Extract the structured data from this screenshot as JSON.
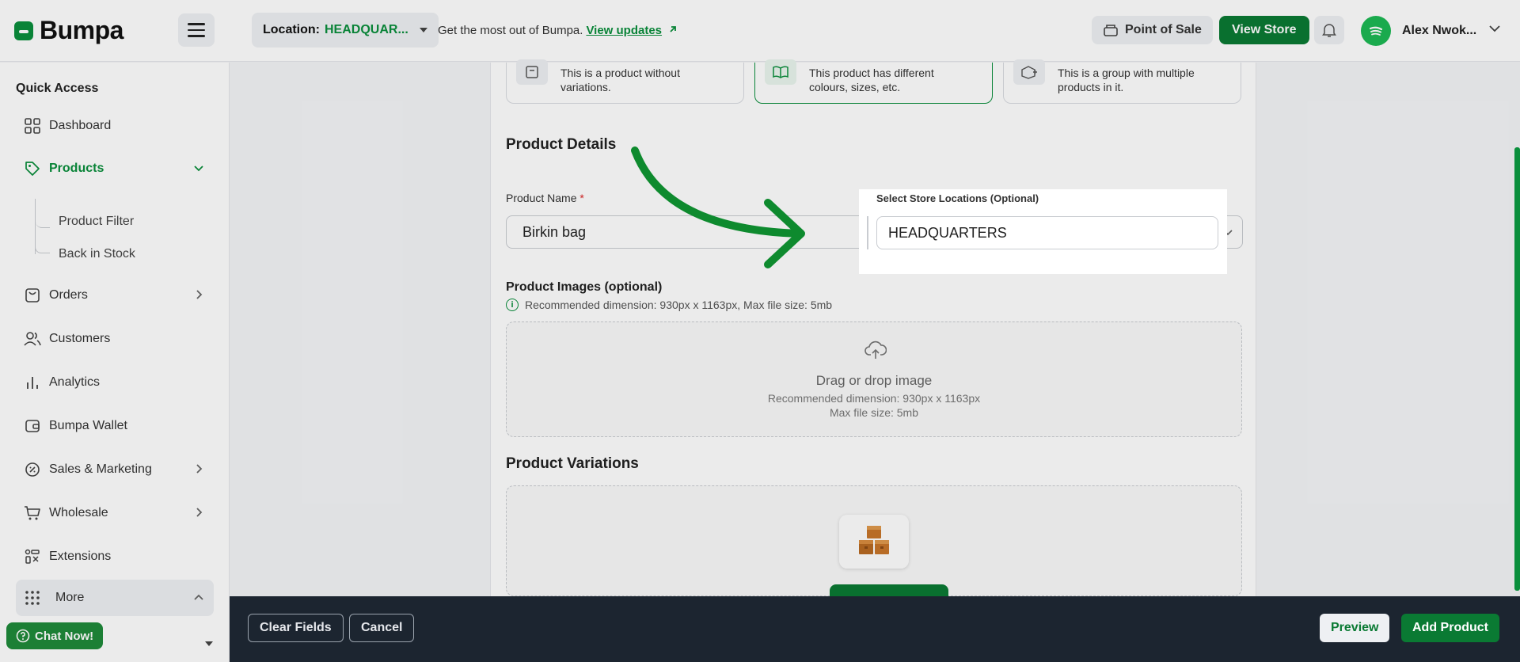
{
  "header": {
    "logo": "Bumpa",
    "location_label": "Location:",
    "location_value": "HEADQUAR...",
    "promo_text": "Get the most out of Bumpa.",
    "promo_link": "View updates",
    "pos_label": "Point of Sale",
    "view_store_label": "View Store",
    "user_name": "Alex Nwok..."
  },
  "sidebar": {
    "quick_access": "Quick Access",
    "items": [
      {
        "label": "Dashboard"
      },
      {
        "label": "Products"
      },
      {
        "label": "Orders"
      },
      {
        "label": "Customers"
      },
      {
        "label": "Analytics"
      },
      {
        "label": "Bumpa Wallet"
      },
      {
        "label": "Sales & Marketing"
      },
      {
        "label": "Wholesale"
      },
      {
        "label": "Extensions"
      },
      {
        "label": "More"
      }
    ],
    "sub_items": [
      "Product Filter",
      "Back in Stock"
    ],
    "chat_label": "Chat Now!"
  },
  "main": {
    "type_cards": [
      {
        "desc": "This is a product without variations."
      },
      {
        "desc": "This product has different colours, sizes, etc."
      },
      {
        "desc": "This is a group with multiple products in it."
      }
    ],
    "product_details_title": "Product Details",
    "product_name_label": "Product Name",
    "product_name_required": "*",
    "product_name_value": "Birkin bag",
    "store_locations_label": "Select Store Locations (Optional)",
    "store_locations_value": "HEADQUARTERS",
    "images_title": "Product Images (optional)",
    "images_hint": "Recommended dimension: 930px x 1163px, Max file size: 5mb",
    "dropzone_main": "Drag or drop image",
    "dropzone_dim": "Recommended dimension: 930px x 1163px",
    "dropzone_size": "Max file size: 5mb",
    "variations_title": "Product Variations"
  },
  "bottom_bar": {
    "clear_label": "Clear Fields",
    "cancel_label": "Cancel",
    "preview_label": "Preview",
    "add_label": "Add Product"
  },
  "colors": {
    "brand": "#0a8f3c",
    "brand_dark": "#0a7a33",
    "bottom_bar": "#1c2530"
  }
}
